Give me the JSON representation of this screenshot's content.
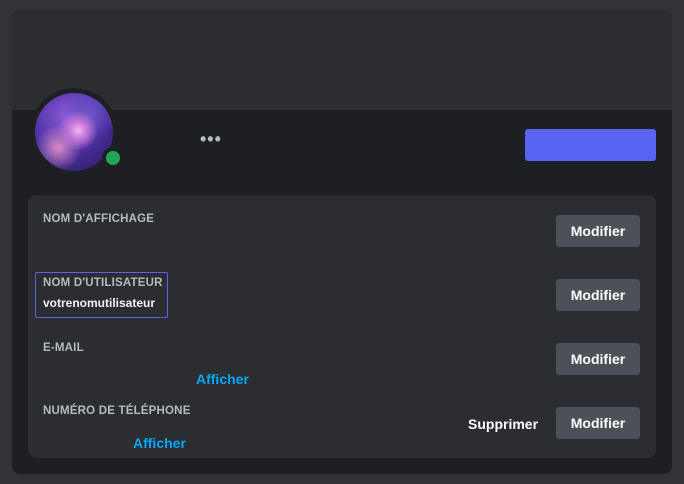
{
  "account": {
    "display_name": {
      "label": "NOM D'AFFICHAGE",
      "edit_label": "Modifier"
    },
    "username": {
      "label": "NOM D'UTILISATEUR",
      "value": "votrenomutilisateur",
      "edit_label": "Modifier"
    },
    "email": {
      "label": "E-MAIL",
      "reveal_label": "Afficher",
      "edit_label": "Modifier"
    },
    "phone": {
      "label": "NUMÉRO DE TÉLÉPHONE",
      "reveal_label": "Afficher",
      "remove_label": "Supprimer",
      "edit_label": "Modifier"
    }
  },
  "header": {
    "more_label": "•••",
    "status": "online"
  },
  "colors": {
    "accent": "#5865f2",
    "online": "#23a55a",
    "link": "#00a8fc",
    "secondary_button": "#4e5058"
  }
}
